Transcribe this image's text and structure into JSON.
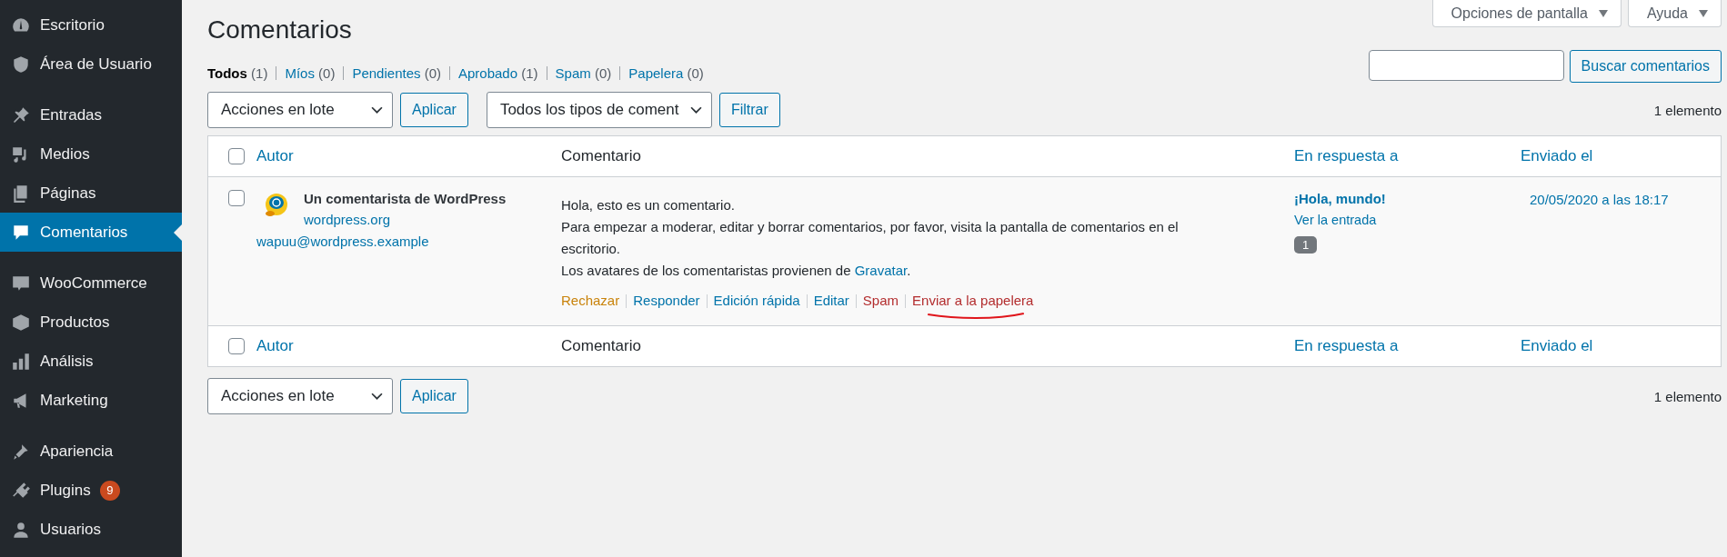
{
  "sidebar": {
    "groups": [
      {
        "items": [
          {
            "label": "Escritorio",
            "selected": false
          },
          {
            "label": "Área de Usuario",
            "selected": false
          }
        ]
      },
      {
        "items": [
          {
            "label": "Entradas",
            "selected": false
          },
          {
            "label": "Medios",
            "selected": false
          },
          {
            "label": "Páginas",
            "selected": false
          },
          {
            "label": "Comentarios",
            "selected": true
          }
        ]
      },
      {
        "items": [
          {
            "label": "WooCommerce",
            "selected": false
          },
          {
            "label": "Productos",
            "selected": false
          },
          {
            "label": "Análisis",
            "selected": false
          },
          {
            "label": "Marketing",
            "selected": false
          }
        ]
      },
      {
        "items": [
          {
            "label": "Apariencia",
            "selected": false
          },
          {
            "label": "Plugins",
            "selected": false,
            "badge": "9"
          },
          {
            "label": "Usuarios",
            "selected": false
          }
        ]
      }
    ]
  },
  "screen_meta": [
    {
      "label": "Opciones de pantalla"
    },
    {
      "label": "Ayuda"
    }
  ],
  "page": {
    "title": "Comentarios"
  },
  "filters": [
    {
      "label": "Todos",
      "count": "(1)",
      "selected": true
    },
    {
      "label": "Míos",
      "count": "(0)",
      "selected": false
    },
    {
      "label": "Pendientes",
      "count": "(0)",
      "selected": false
    },
    {
      "label": "Aprobado",
      "count": "(1)",
      "selected": false
    },
    {
      "label": "Spam",
      "count": "(0)",
      "selected": false
    },
    {
      "label": "Papelera",
      "count": "(0)",
      "selected": false
    }
  ],
  "search": {
    "button": "Buscar comentarios"
  },
  "top_nav": {
    "bulk_action": "Acciones en lote",
    "apply": "Aplicar",
    "type_filter": "Todos los tipos de coment",
    "filter": "Filtrar",
    "count": "1 elemento"
  },
  "table": {
    "columns": [
      {
        "label": "Autor",
        "sortable": true
      },
      {
        "label": "Comentario",
        "sortable": false
      },
      {
        "label": "En respuesta a",
        "sortable": true
      },
      {
        "label": "Enviado el",
        "sortable": true
      }
    ],
    "rows": [
      {
        "checked": false,
        "author": {
          "name": "Un comentarista de WordPress",
          "url": "wordpress.org",
          "email": "wapuu@wordpress.example"
        },
        "paragraphs": [
          {
            "text": "Hola, esto es un comentario."
          },
          {
            "text": "Para empezar a moderar, editar y borrar comentarios, por favor, visita la pantalla de comentarios en el escritorio."
          },
          {
            "text": "Los avatares de los comentaristas provienen de ",
            "link": "Gravatar",
            "tail": "."
          }
        ],
        "actions": [
          {
            "label": "Rechazar",
            "kind": "warning"
          },
          {
            "label": "Responder",
            "kind": "link"
          },
          {
            "label": "Edición rápida",
            "kind": "link"
          },
          {
            "label": "Editar",
            "kind": "link"
          },
          {
            "label": "Spam",
            "kind": "danger"
          },
          {
            "label": "Enviar a la papelera",
            "kind": "danger",
            "underlined": true
          }
        ],
        "in_response": {
          "title": "¡Hola, mundo!",
          "view": "Ver la entrada",
          "count": "1"
        },
        "date": "20/05/2020 a las 18:17"
      }
    ],
    "footer_columns": [
      {
        "label": "Autor",
        "sortable": true
      },
      {
        "label": "Comentario",
        "sortable": false
      },
      {
        "label": "En respuesta a",
        "sortable": true
      },
      {
        "label": "Enviado el",
        "sortable": true
      }
    ],
    "footer_checked": false,
    "header_checked": false
  },
  "bottom_nav": {
    "bulk_action": "Acciones en lote",
    "apply": "Aplicar",
    "count": "1 elemento"
  }
}
